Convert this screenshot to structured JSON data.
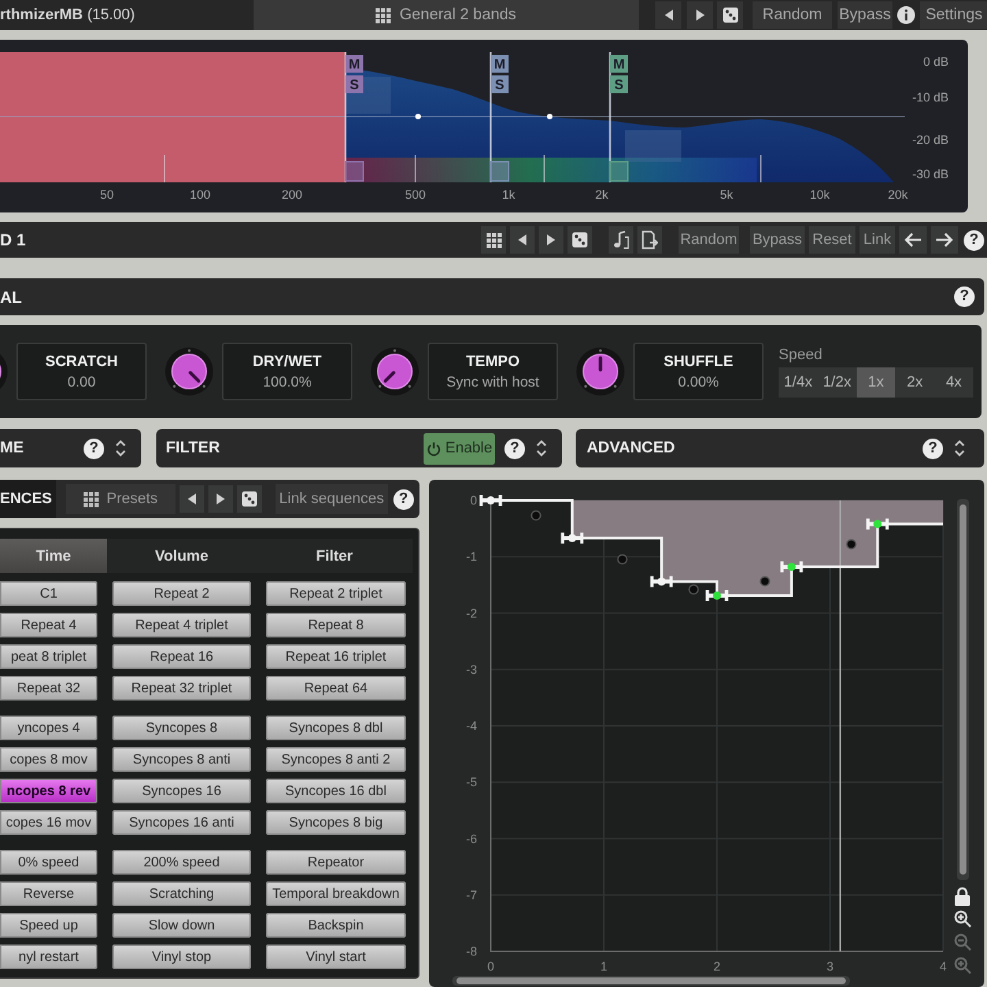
{
  "header": {
    "title": "**rthmizerMB** (15.00)",
    "preset": "General 2 bands",
    "random": "Random",
    "bypass": "Bypass",
    "settings": "Settings"
  },
  "spectrum": {
    "bands": [
      {
        "selected": true,
        "color": "#c45c6c"
      },
      {
        "selected": false,
        "color": "#8e74ac",
        "mute": "M",
        "solo": "S"
      },
      {
        "selected": false,
        "color": "#7c90b4",
        "mute": "M",
        "solo": "S"
      },
      {
        "selected": false,
        "color": "#5e9e84",
        "mute": "M",
        "solo": "S"
      }
    ],
    "freq_labels": [
      "50",
      "100",
      "200",
      "500",
      "1k",
      "2k",
      "5k",
      "10k",
      "20k"
    ],
    "db_labels": [
      "0 dB",
      "-10 dB",
      "-20 dB",
      "-30 dB"
    ]
  },
  "band_bar": {
    "title": "D 1",
    "random": "Random",
    "bypass": "Bypass",
    "reset": "Reset",
    "link": "Link",
    "help": "?"
  },
  "global_bar": {
    "title": "AL",
    "help": "?"
  },
  "parameters": [
    {
      "label": "SCRATCH",
      "value": "0.00"
    },
    {
      "label": "DRY/WET",
      "value": "100.0%",
      "level": 1
    },
    {
      "label": "TEMPO",
      "value": "Sync with host",
      "level": 0
    },
    {
      "label": "SHUFFLE",
      "value": "0.00%",
      "level": 0.5
    }
  ],
  "speed": {
    "label": "Speed",
    "options": [
      {
        "label": "1/4x",
        "selected": false
      },
      {
        "label": "1/2x",
        "selected": false
      },
      {
        "label": "1x",
        "selected": true
      },
      {
        "label": "2x",
        "selected": false
      },
      {
        "label": "4x",
        "selected": false
      }
    ]
  },
  "sections": [
    {
      "label": "ME",
      "help": "?"
    },
    {
      "label": "FILTER",
      "enable": {
        "label": "Enable",
        "on": true
      },
      "help": "?"
    },
    {
      "label": "ADVANCED",
      "help": "?"
    }
  ],
  "sequences": {
    "title": "ENCES",
    "presets": "Presets",
    "link": "Link sequences",
    "help": "?",
    "columns": [
      {
        "label": "Time",
        "selected": true
      },
      {
        "label": "Volume",
        "selected": false
      },
      {
        "label": "Filter",
        "selected": false
      }
    ],
    "groups": [
      [
        [
          {
            "label": "C1",
            "selected": false
          },
          {
            "label": "Repeat 2",
            "selected": false
          },
          {
            "label": "Repeat 2 triplet",
            "selected": false
          }
        ],
        [
          {
            "label": "Repeat 4",
            "selected": false
          },
          {
            "label": "Repeat 4 triplet",
            "selected": false
          },
          {
            "label": "Repeat 8",
            "selected": false
          }
        ],
        [
          {
            "label": "peat 8 triplet",
            "selected": false
          },
          {
            "label": "Repeat 16",
            "selected": false
          },
          {
            "label": "Repeat 16 triplet",
            "selected": false
          }
        ],
        [
          {
            "label": "Repeat 32",
            "selected": false
          },
          {
            "label": "Repeat 32 triplet",
            "selected": false
          },
          {
            "label": "Repeat 64",
            "selected": false
          }
        ]
      ],
      [
        [
          {
            "label": "yncopes 4",
            "selected": false
          },
          {
            "label": "Syncopes 8",
            "selected": false
          },
          {
            "label": "Syncopes 8 dbl",
            "selected": false
          }
        ],
        [
          {
            "label": "copes 8 mov",
            "selected": false
          },
          {
            "label": "Syncopes 8 anti",
            "selected": false
          },
          {
            "label": "Syncopes 8 anti 2",
            "selected": false
          }
        ],
        [
          {
            "label": "ncopes 8 rev",
            "selected": true
          },
          {
            "label": "Syncopes 16",
            "selected": false
          },
          {
            "label": "Syncopes 16 dbl",
            "selected": false
          }
        ],
        [
          {
            "label": "copes 16 mov",
            "selected": false
          },
          {
            "label": "Syncopes 16 anti",
            "selected": false
          },
          {
            "label": "Syncopes 8 big",
            "selected": false
          }
        ]
      ],
      [
        [
          {
            "label": "0% speed",
            "selected": false
          },
          {
            "label": "200% speed",
            "selected": false
          },
          {
            "label": "Repeator",
            "selected": false
          }
        ],
        [
          {
            "label": "Reverse",
            "selected": false
          },
          {
            "label": "Scratching",
            "selected": false
          },
          {
            "label": "Temporal breakdown",
            "selected": false
          }
        ],
        [
          {
            "label": "Speed up",
            "selected": false
          },
          {
            "label": "Slow down",
            "selected": false
          },
          {
            "label": "Backspin",
            "selected": false
          }
        ],
        [
          {
            "label": "nyl restart",
            "selected": false
          },
          {
            "label": "Vinyl stop",
            "selected": false
          },
          {
            "label": "Vinyl start",
            "selected": false
          }
        ]
      ]
    ]
  },
  "graph": {
    "chart_data": {
      "type": "area",
      "x": [
        0,
        0.72,
        0.72,
        1.51,
        1.51,
        2,
        2,
        2.66,
        2.66,
        3.42,
        3.42,
        4
      ],
      "series": [
        {
          "color": "#877c82",
          "values": [
            0,
            0,
            -0.67,
            -0.67,
            -1.44,
            -1.44,
            -1.69,
            -1.69,
            -1.18,
            -1.18,
            -0.42,
            -0.42
          ],
          "marker": "circle"
        }
      ],
      "xlim": [
        0,
        4
      ],
      "ylim": [
        -8,
        0
      ],
      "xticks": [
        0,
        1,
        2,
        3,
        4
      ],
      "yticks": [
        0,
        -1,
        -2,
        -3,
        -4,
        -5,
        -6,
        -7,
        -8
      ],
      "grid": true,
      "ref_lines": [
        {
          "axis": "x",
          "value": 3.09
        }
      ]
    },
    "handles": [
      {
        "selected": false
      },
      {
        "selected": false
      },
      {
        "selected": false
      },
      {
        "selected": true
      },
      {
        "selected": true
      },
      {
        "selected": true
      }
    ]
  }
}
